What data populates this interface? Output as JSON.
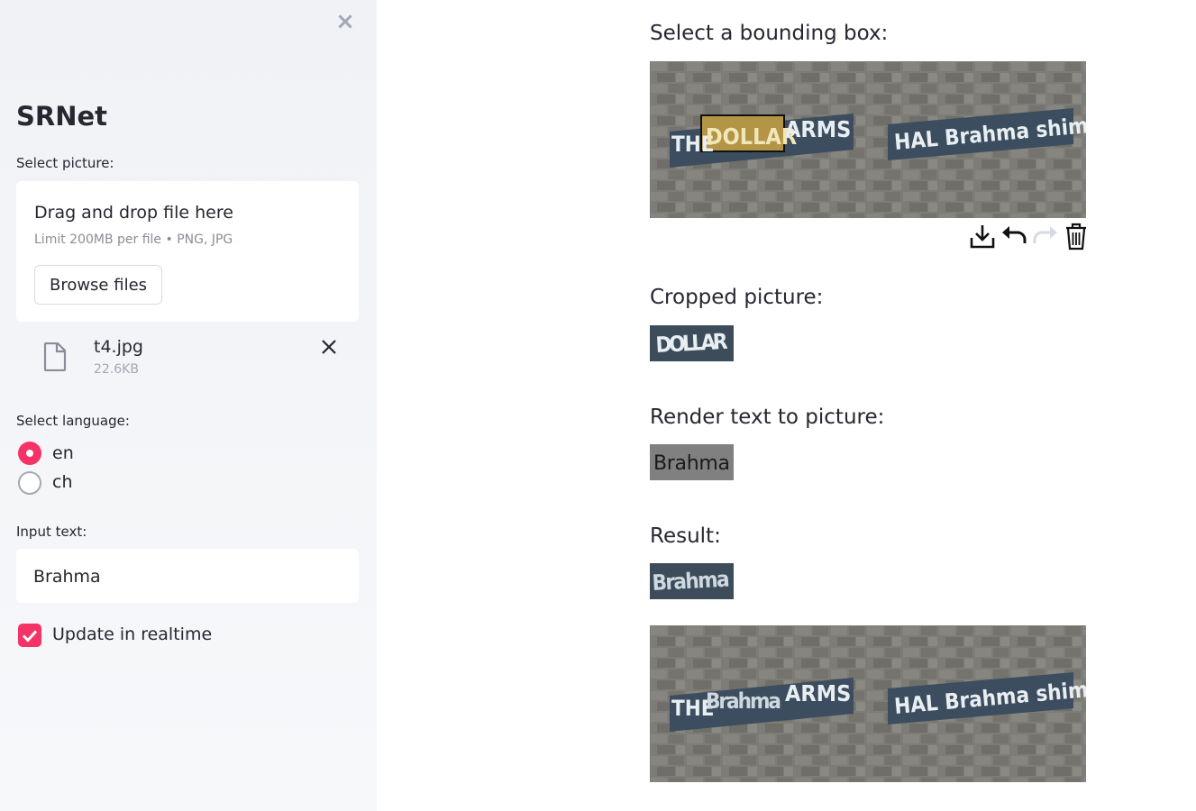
{
  "sidebar": {
    "close_glyph": "×",
    "title": "SRNet",
    "select_picture_label": "Select picture:",
    "uploader": {
      "drag_text": "Drag and drop file here",
      "limit_text": "Limit 200MB per file • PNG, JPG",
      "browse_label": "Browse files"
    },
    "file": {
      "name": "t4.jpg",
      "size": "22.6KB",
      "icon": "file-icon"
    },
    "language_label": "Select language:",
    "language_options": [
      {
        "label": "en",
        "selected": true
      },
      {
        "label": "ch",
        "selected": false
      }
    ],
    "input_label": "Input text:",
    "input_value": "Brahma",
    "realtime_label": "Update in realtime",
    "realtime_checked": true
  },
  "main": {
    "bbox_title": "Select a bounding box:",
    "cropped_title": "Cropped picture:",
    "render_title": "Render text to picture:",
    "result_title": "Result:",
    "source_image": {
      "left_text_prefix": "THE",
      "left_text_selected": "DOLLAR",
      "left_text_suffix": "ARMS",
      "right_text": "HAL Brahma shim"
    },
    "cropped_text": "DOLLAR",
    "rendered_text": "Brahma",
    "result_text": "Brahma",
    "result_image": {
      "left_text_prefix": "THE",
      "left_text_replaced": "Brahma",
      "left_text_suffix": "ARMS",
      "right_text": "HAL Brahma shim"
    },
    "toolbar": [
      "download-icon",
      "undo-icon",
      "redo-icon",
      "trash-icon"
    ]
  },
  "colors": {
    "accent": "#f63366",
    "sidebar_bg": "#f0f2f6",
    "sign_blue": "#3b4d5e",
    "sign_text": "#e8eef2",
    "wall": "#7b7a74"
  }
}
